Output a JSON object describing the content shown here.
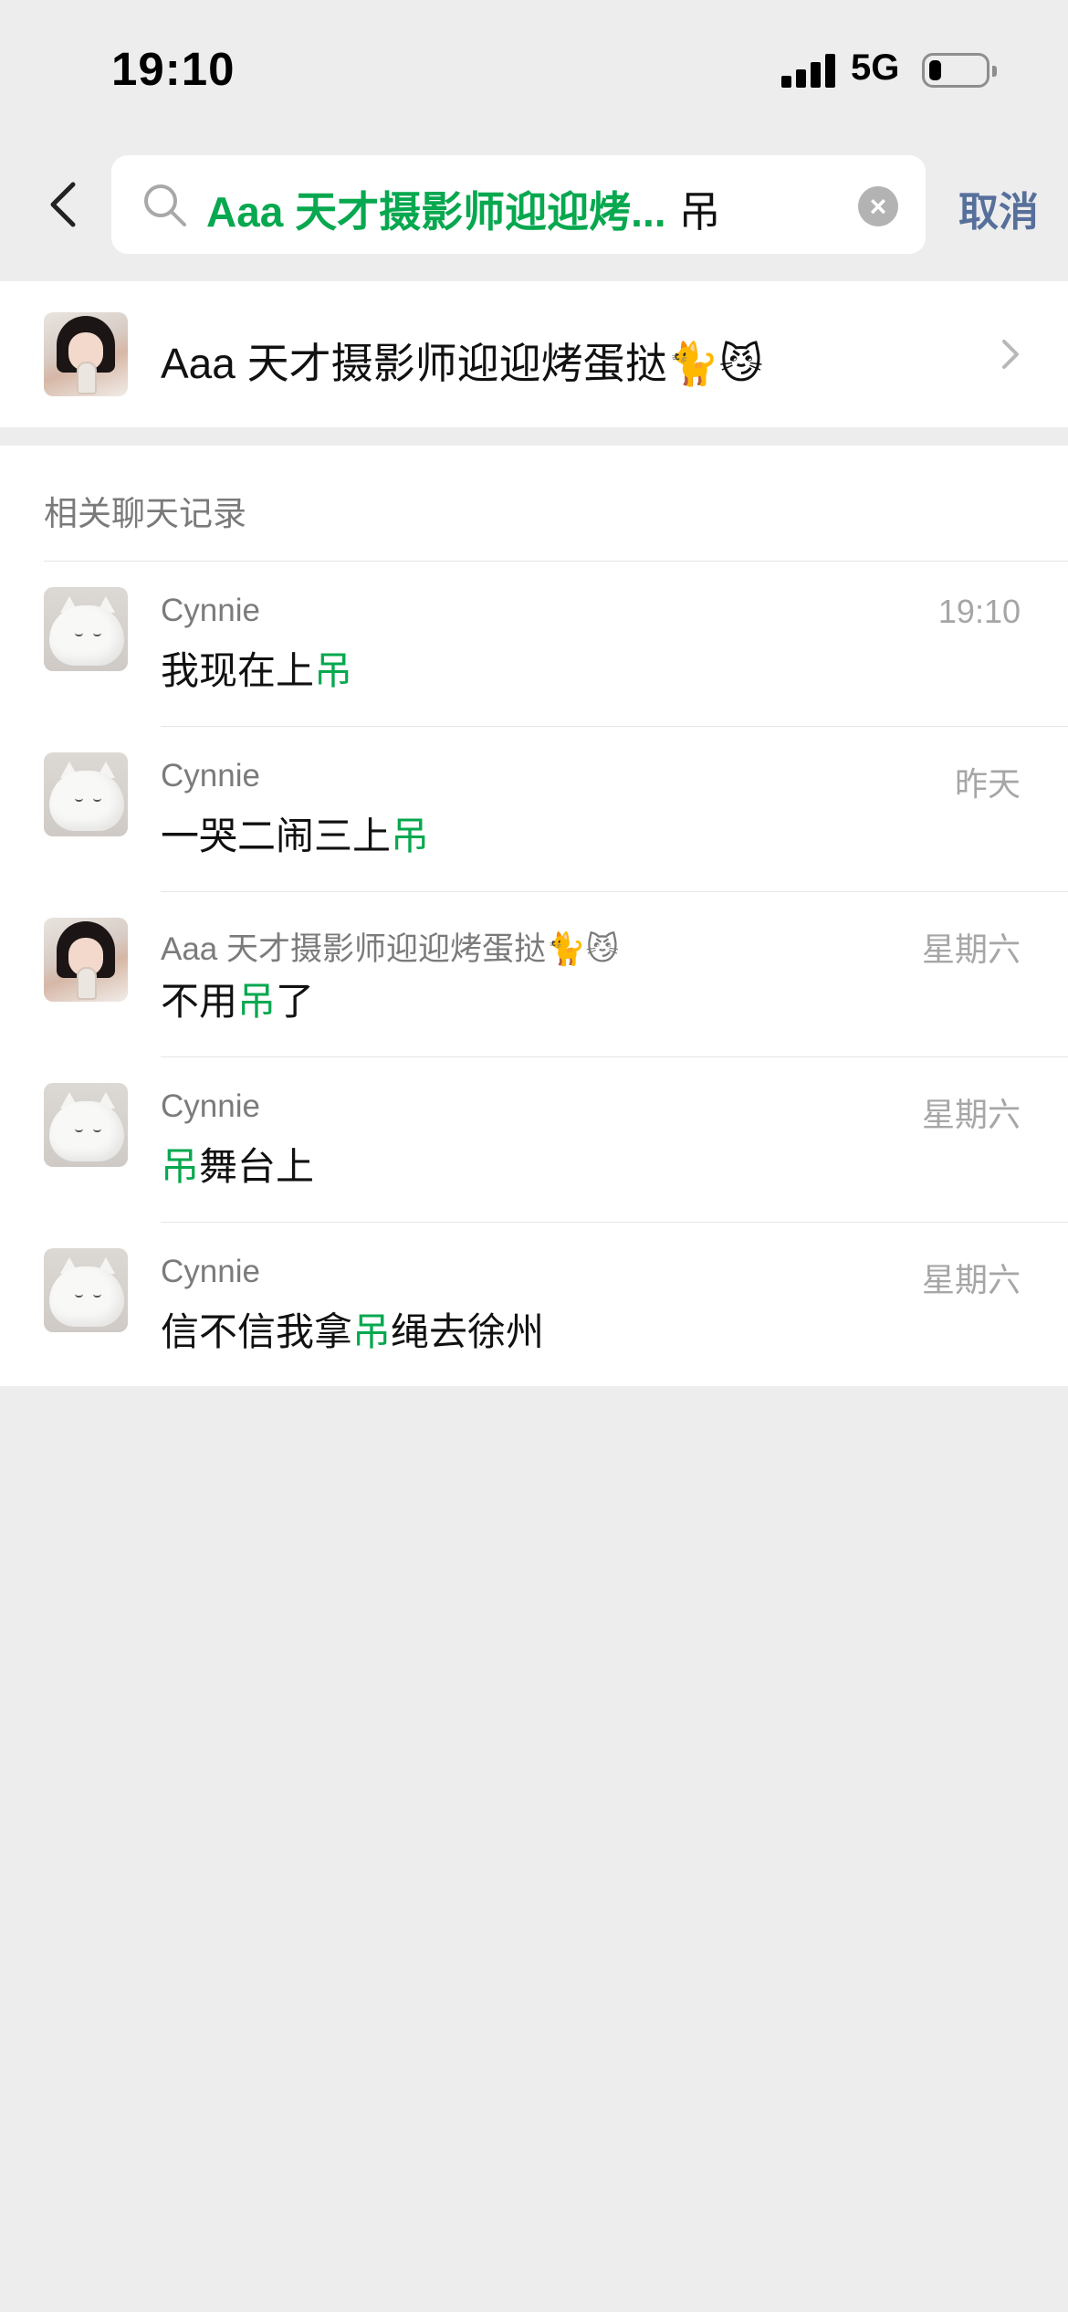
{
  "status_bar": {
    "time": "19:10",
    "network": "5G",
    "battery_level": 0.2
  },
  "search": {
    "contact_chip": "Aaa 天才摄影师迎迎烤...",
    "term": "吊",
    "cancel_label": "取消"
  },
  "contact_result": {
    "name": "Aaa 天才摄影师迎迎烤蛋挞🐈😼"
  },
  "chat_records": {
    "section_title": "相关聊天记录",
    "items": [
      {
        "sender": "Cynnie",
        "time": "19:10",
        "before": "我现在上",
        "highlight": "吊",
        "after": ""
      },
      {
        "sender": "Cynnie",
        "time": "昨天",
        "before": "一哭二闹三上",
        "highlight": "吊",
        "after": ""
      },
      {
        "sender": "Aaa 天才摄影师迎迎烤蛋挞🐈😼",
        "time": "星期六",
        "before": "不用",
        "highlight": "吊",
        "after": "了"
      },
      {
        "sender": "Cynnie",
        "time": "星期六",
        "before": "",
        "highlight": "吊",
        "after": "舞台上"
      },
      {
        "sender": "Cynnie",
        "time": "星期六",
        "before": "信不信我拿",
        "highlight": "吊",
        "after": "绳去徐州"
      }
    ]
  },
  "colors": {
    "highlight": "#07a84f",
    "cancel": "#57709b",
    "background": "#ededed"
  }
}
